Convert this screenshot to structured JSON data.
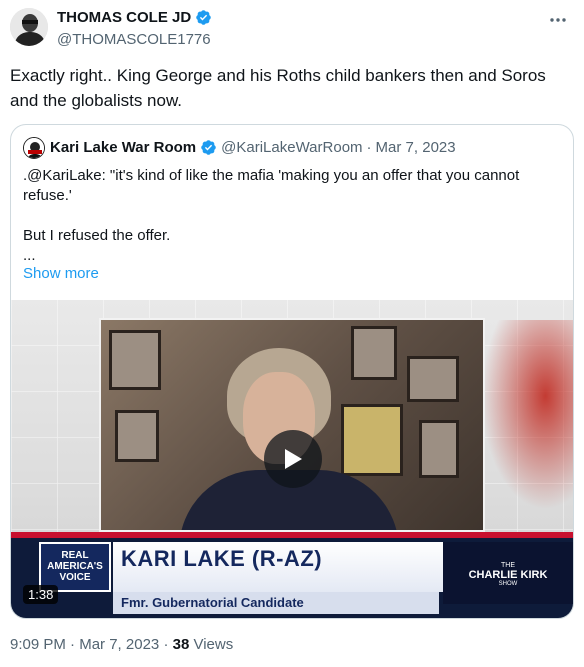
{
  "author": {
    "name": "THOMAS COLE JD",
    "handle": "@THOMASCOLE1776"
  },
  "tweet_text": "Exactly right..  King George and his Roths child bankers then and Soros and the globalists now.",
  "quote": {
    "name": "Kari Lake War Room",
    "handle": "@KariLakeWarRoom",
    "separator": "·",
    "date": "Mar 7, 2023",
    "lines": [
      ".@KariLake: \"it's kind of like the mafia 'making you an offer that you cannot refuse.'",
      "But I refused the offer.",
      "..."
    ],
    "show_more": "Show more",
    "video": {
      "duration": "1:38",
      "logo_text": "REAL AMERICA'S VOICE",
      "banner_title": "KARI LAKE (R-AZ)",
      "banner_subtitle": "Fmr. Gubernatorial Candidate",
      "show_line1": "THE",
      "show_line2": "CHARLIE KIRK",
      "show_line3": "SHOW"
    }
  },
  "footer": {
    "time": "9:09 PM",
    "sep1": "·",
    "date": "Mar 7, 2023",
    "sep2": "·",
    "views_count": "38",
    "views_label": "Views"
  },
  "icons": {
    "verified": "verified-badge-icon",
    "more": "more-options-icon",
    "play": "play-icon"
  },
  "colors": {
    "verified": "#1d9bf0",
    "link": "#1d9bf0",
    "secondary_text": "#536471"
  }
}
